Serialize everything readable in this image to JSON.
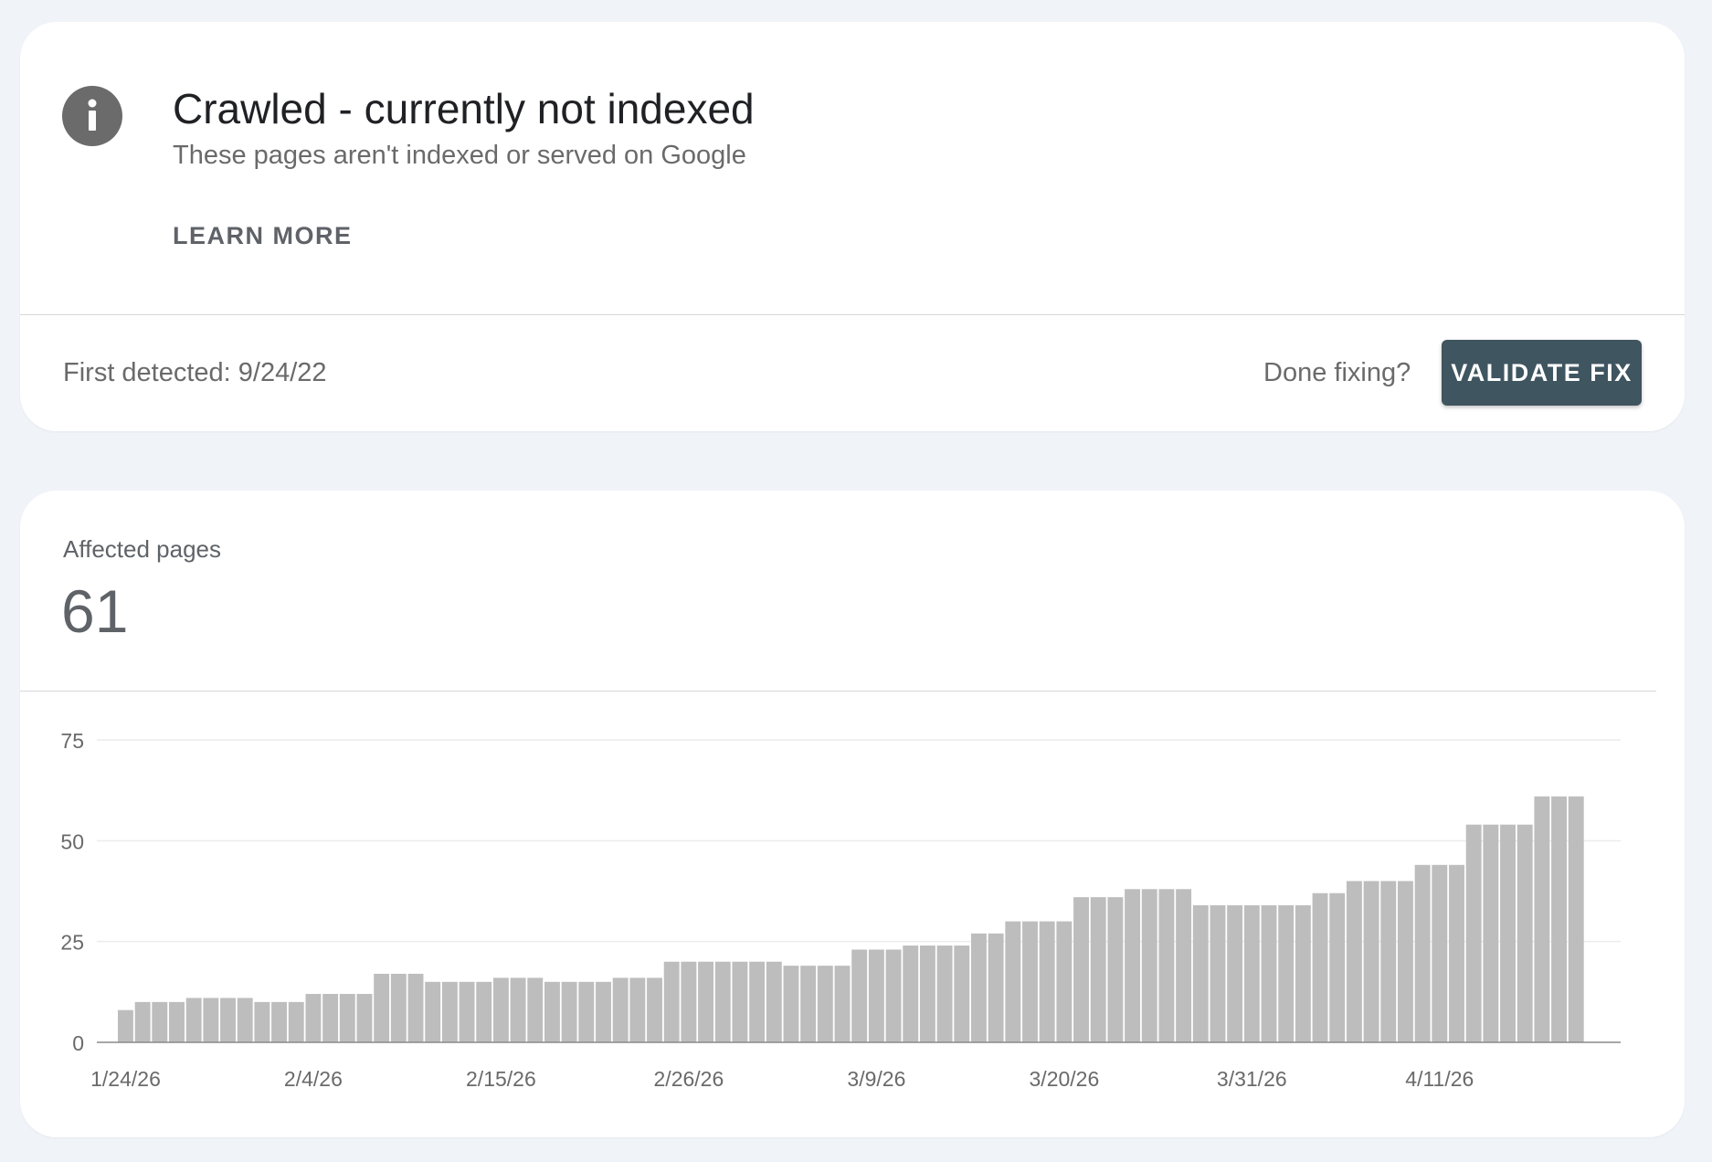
{
  "issue": {
    "title": "Crawled - currently not indexed",
    "subtitle": "These pages aren't indexed or served on Google",
    "learn_more": "LEARN MORE",
    "icon": "info-icon"
  },
  "footer": {
    "first_detected": "First detected: 9/24/22",
    "done_fixing": "Done fixing?",
    "validate_button": "VALIDATE FIX"
  },
  "metric": {
    "label": "Affected pages",
    "value": "61"
  },
  "colors": {
    "bar": "#bdbdbd",
    "button": "#3f5560",
    "icon": "#6b6b6b"
  },
  "chart_data": {
    "type": "bar",
    "ylim": [
      0,
      75
    ],
    "yticks": [
      0,
      25,
      50,
      75
    ],
    "grid": true,
    "x_start": "1/24/26",
    "x": [
      "1/24/26",
      "1/25/26",
      "1/26/26",
      "1/27/26",
      "1/28/26",
      "1/29/26",
      "1/30/26",
      "1/31/26",
      "2/1/26",
      "2/2/26",
      "2/3/26",
      "2/4/26",
      "2/5/26",
      "2/6/26",
      "2/7/26",
      "2/8/26",
      "2/9/26",
      "2/10/26",
      "2/11/26",
      "2/12/26",
      "2/13/26",
      "2/14/26",
      "2/15/26",
      "2/16/26",
      "2/17/26",
      "2/18/26",
      "2/19/26",
      "2/20/26",
      "2/21/26",
      "2/22/26",
      "2/23/26",
      "2/24/26",
      "2/25/26",
      "2/26/26",
      "2/27/26",
      "2/28/26",
      "3/1/26",
      "3/2/26",
      "3/3/26",
      "3/4/26",
      "3/5/26",
      "3/6/26",
      "3/7/26",
      "3/8/26",
      "3/9/26",
      "3/10/26",
      "3/11/26",
      "3/12/26",
      "3/13/26",
      "3/14/26",
      "3/15/26",
      "3/16/26",
      "3/17/26",
      "3/18/26",
      "3/19/26",
      "3/20/26",
      "3/21/26",
      "3/22/26",
      "3/23/26",
      "3/24/26",
      "3/25/26",
      "3/26/26",
      "3/27/26",
      "3/28/26",
      "3/29/26",
      "3/30/26",
      "3/31/26",
      "4/1/26",
      "4/2/26",
      "4/3/26",
      "4/4/26",
      "4/5/26",
      "4/6/26",
      "4/7/26",
      "4/8/26",
      "4/9/26",
      "4/10/26",
      "4/11/26",
      "4/12/26",
      "4/13/26",
      "4/14/26",
      "4/15/26",
      "4/16/26",
      "4/17/26",
      "4/18/26",
      "4/19/26",
      "4/20/26",
      "4/21/26",
      "4/22/26"
    ],
    "x_tick_labels": [
      "1/24/26",
      "2/4/26",
      "2/15/26",
      "2/26/26",
      "3/9/26",
      "3/20/26",
      "3/31/26",
      "4/11/26"
    ],
    "series": [
      {
        "values": [
          8,
          10,
          10,
          10,
          11,
          11,
          11,
          11,
          10,
          10,
          10,
          12,
          12,
          12,
          12,
          17,
          17,
          17,
          15,
          15,
          15,
          15,
          16,
          16,
          16,
          15,
          15,
          15,
          15,
          16,
          16,
          16,
          20,
          20,
          20,
          20,
          20,
          20,
          20,
          19,
          19,
          19,
          19,
          23,
          23,
          23,
          24,
          24,
          24,
          24,
          27,
          27,
          30,
          30,
          30,
          30,
          36,
          36,
          36,
          38,
          38,
          38,
          38,
          34,
          34,
          34,
          34,
          34,
          34,
          34,
          37,
          37,
          40,
          40,
          40,
          40,
          44,
          44,
          44,
          54,
          54,
          54,
          54,
          61,
          61,
          61
        ]
      }
    ]
  }
}
